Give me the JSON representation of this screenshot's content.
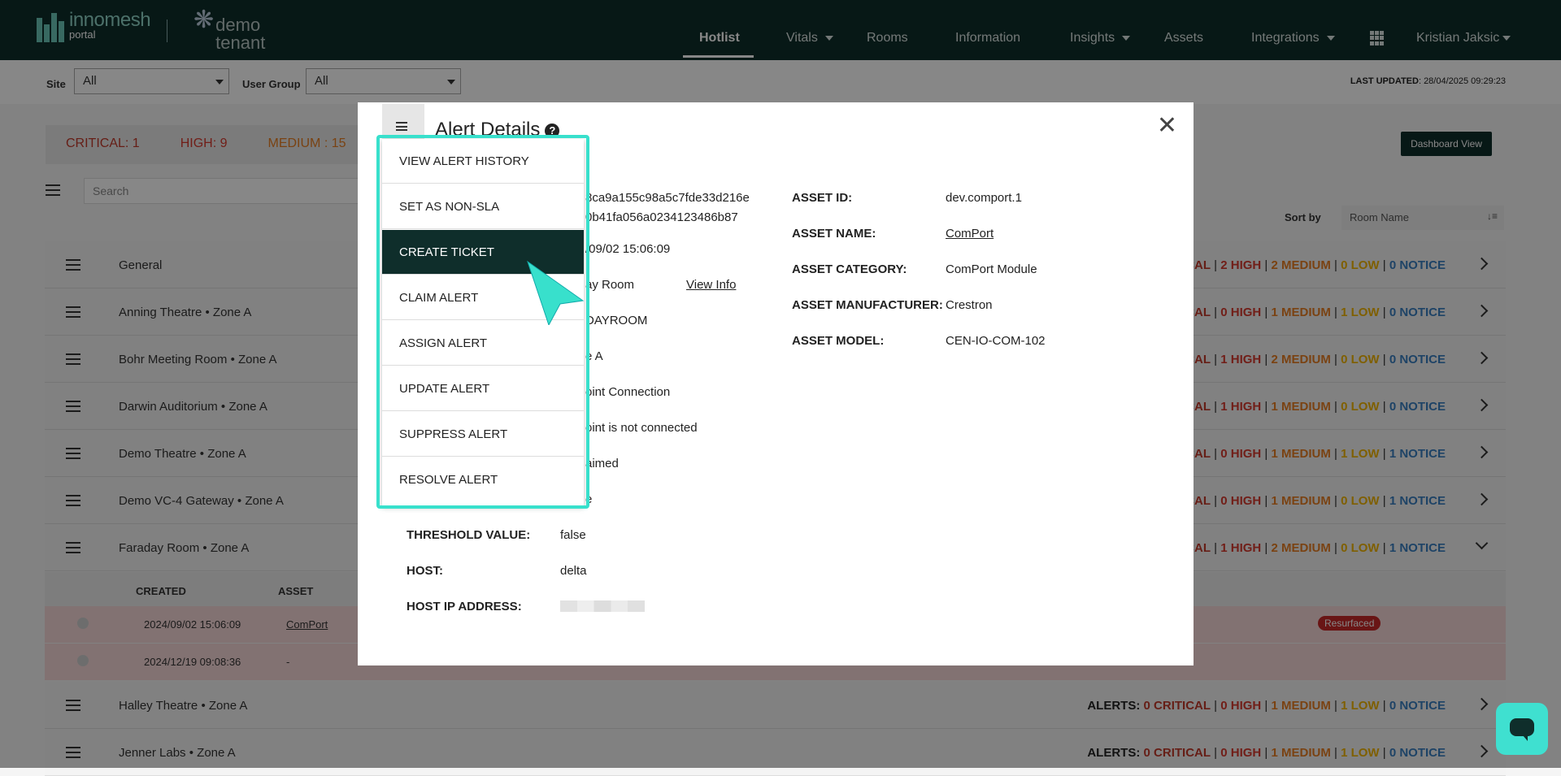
{
  "brand": {
    "logo_main": "innomesh",
    "logo_sub": "portal",
    "tenant_line1": "demo",
    "tenant_line2": "tenant"
  },
  "nav": {
    "items": [
      "Hotlist",
      "Vitals",
      "Rooms",
      "Information",
      "Insights",
      "Assets",
      "Integrations"
    ],
    "active": "Hotlist",
    "user": "Kristian Jaksic"
  },
  "filters": {
    "site_label": "Site",
    "site_value": "All",
    "usergroup_label": "User Group",
    "usergroup_value": "All",
    "last_updated_label": "LAST UPDATED",
    "last_updated_value": ": 28/04/2025 09:29:23"
  },
  "severity_tabs": [
    "CRITICAL: 1",
    "HIGH: 9",
    "MEDIUM : 15"
  ],
  "dashboard_button": "Dashboard View",
  "search_placeholder": "Search",
  "sort": {
    "label": "Sort by",
    "value": "Room Name"
  },
  "rooms": [
    {
      "name": "General",
      "zone": "",
      "stats_prefix": "",
      "critical": "CRITICAL",
      "high": "2 HIGH",
      "medium": "2 MEDIUM",
      "low": "0 LOW",
      "notice": "0 NOTICE"
    },
    {
      "name": "Anning Theatre",
      "zone": "Zone A",
      "stats_prefix": "",
      "critical": "RITICAL",
      "high": "0 HIGH",
      "medium": "1 MEDIUM",
      "low": "1 LOW",
      "notice": "0 NOTICE"
    },
    {
      "name": "Bohr Meeting Room",
      "zone": "Zone A",
      "stats_prefix": "",
      "critical": "RITICAL",
      "high": "1 HIGH",
      "medium": "2 MEDIUM",
      "low": "0 LOW",
      "notice": "0 NOTICE"
    },
    {
      "name": "Darwin Auditorium",
      "zone": "Zone A",
      "stats_prefix": "",
      "critical": "RITICAL",
      "high": "1 HIGH",
      "medium": "1 MEDIUM",
      "low": "0 LOW",
      "notice": "0 NOTICE"
    },
    {
      "name": "Demo Theatre",
      "zone": "Zone A",
      "stats_prefix": "",
      "critical": "RITICAL",
      "high": "0 HIGH",
      "medium": "1 MEDIUM",
      "low": "1 LOW",
      "notice": "1 NOTICE"
    },
    {
      "name": "Demo VC-4 Gateway",
      "zone": "Zone A",
      "stats_prefix": "",
      "critical": "RITICAL",
      "high": "0 HIGH",
      "medium": "1 MEDIUM",
      "low": "0 LOW",
      "notice": "1 NOTICE"
    },
    {
      "name": "Faraday Room",
      "zone": "Zone A",
      "stats_prefix": "",
      "critical": "RITICAL",
      "high": "1 HIGH",
      "medium": "2 MEDIUM",
      "low": "0 LOW",
      "notice": "1 NOTICE"
    },
    {
      "name": "Halley Theatre",
      "zone": "Zone A",
      "stats_prefix": "ALERTS: ",
      "critical": "0 CRITICAL",
      "high": "0 HIGH",
      "medium": "1 MEDIUM",
      "low": "1 LOW",
      "notice": "0 NOTICE"
    },
    {
      "name": "Jenner Labs",
      "zone": "Zone A",
      "stats_prefix": "ALERTS: ",
      "critical": "0 CRITICAL",
      "high": "0 HIGH",
      "medium": "1 MEDIUM",
      "low": "1 LOW",
      "notice": "0 NOTICE"
    }
  ],
  "expanded": {
    "headers": [
      "CREATED",
      "ASSET"
    ],
    "rows": [
      {
        "created": "2024/09/02 15:06:09",
        "asset": "ComPort",
        "badge": "Resurfaced"
      },
      {
        "created": "2024/12/19 09:08:36",
        "asset": "-",
        "badge": ""
      }
    ]
  },
  "modal": {
    "title": "Alert Details",
    "left": [
      {
        "label": "",
        "value": "8ca9a155c98a5c7fde33d216e"
      },
      {
        "label": "",
        "value": "0b41fa056a0234123486b87"
      },
      {
        "label": "",
        "value": "/09/02 15:06:09"
      },
      {
        "label": "",
        "value": "ay Room"
      },
      {
        "label": "",
        "value": "DAYROOM"
      },
      {
        "label": "",
        "value": "e A"
      },
      {
        "label": "",
        "value": "oint Connection"
      },
      {
        "label": "",
        "value": "oint is not connected"
      },
      {
        "label": "",
        "value": "aimed"
      },
      {
        "label": "",
        "value": "e"
      },
      {
        "label": "THRESHOLD VALUE:",
        "value": "false"
      },
      {
        "label": "HOST:",
        "value": "delta"
      },
      {
        "label": "HOST IP ADDRESS:",
        "value": ""
      }
    ],
    "view_info": "View Info",
    "right": [
      {
        "label": "ASSET ID:",
        "value": "dev.comport.1"
      },
      {
        "label": "ASSET NAME:",
        "value": "ComPort"
      },
      {
        "label": "ASSET CATEGORY:",
        "value": "ComPort Module"
      },
      {
        "label": "ASSET MANUFACTURER:",
        "value": "Crestron"
      },
      {
        "label": "ASSET MODEL:",
        "value": "CEN-IO-COM-102"
      }
    ]
  },
  "menu": {
    "items": [
      "VIEW ALERT HISTORY",
      "SET AS NON-SLA",
      "CREATE TICKET",
      "CLAIM ALERT",
      "ASSIGN ALERT",
      "UPDATE ALERT",
      "SUPPRESS ALERT",
      "RESOLVE ALERT"
    ],
    "active": "CREATE TICKET"
  },
  "colors": {
    "nav_bg": "#0f2e2b",
    "highlight": "#38e0cc",
    "critical": "#c0392b",
    "medium": "#e67e22",
    "low": "#f0b400",
    "notice": "#3a7fc1"
  }
}
